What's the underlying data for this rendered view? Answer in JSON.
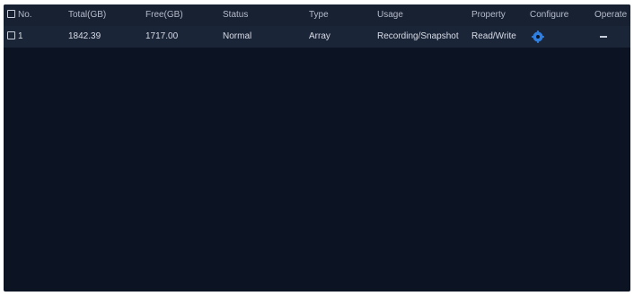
{
  "table": {
    "columns": {
      "no": "No.",
      "total": "Total(GB)",
      "free": "Free(GB)",
      "status": "Status",
      "type": "Type",
      "usage": "Usage",
      "property": "Property",
      "configure": "Configure",
      "operate": "Operate"
    },
    "rows": [
      {
        "no": "1",
        "total": "1842.39",
        "free": "1717.00",
        "status": "Normal",
        "type": "Array",
        "usage": "Recording/Snapshot",
        "property": "Read/Write",
        "configure_icon": "gear-icon",
        "operate": "—"
      }
    ]
  },
  "colors": {
    "panel_bg": "#0c1424",
    "header_bg": "#182132",
    "row_bg": "#1b2538",
    "accent": "#2f7fe0"
  }
}
